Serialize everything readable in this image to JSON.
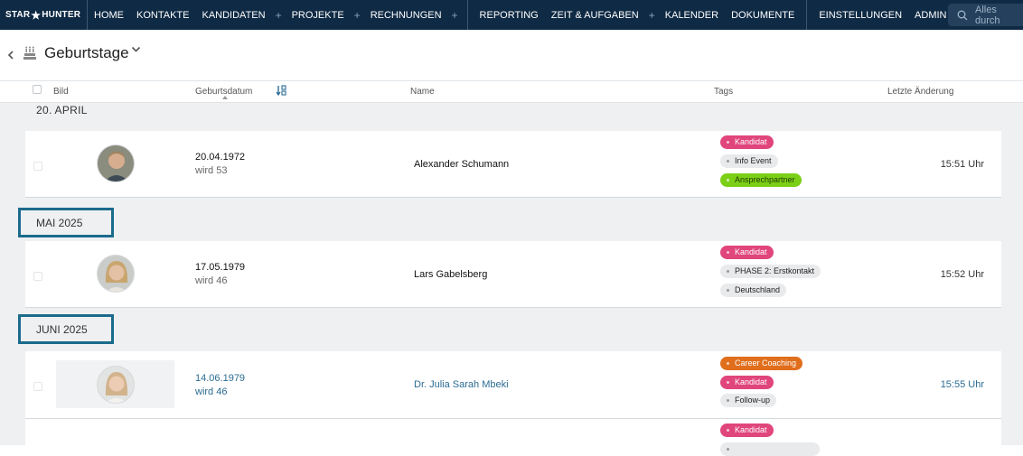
{
  "brand": {
    "logo_left": "STAR",
    "logo_right": "HUNTER"
  },
  "nav": {
    "items": [
      "HOME",
      "KONTAKTE",
      "KANDIDATEN",
      "PROJEKTE",
      "RECHNUNGEN",
      "REPORTING",
      "ZEIT & AUFGABEN",
      "KALENDER",
      "DOKUMENTE",
      "EINSTELLUNGEN",
      "ADMIN"
    ],
    "plus": "+",
    "search_placeholder": "Alles durch"
  },
  "page": {
    "title": "Geburtstage",
    "back_icon": "chevron-left-icon",
    "title_icon": "cake-icon"
  },
  "columns": {
    "bild": "Bild",
    "geburtsdatum": "Geburtsdatum",
    "name": "Name",
    "tags": "Tags",
    "letzte_aenderung": "Letzte Änderung"
  },
  "groups": {
    "april": "20. APRIL",
    "mai": "MAI 2025",
    "juni": "JUNI 2025"
  },
  "rows": [
    {
      "date": "20.04.1972",
      "age": "wird 53",
      "name": "Alexander Schumann",
      "time": "15:51 Uhr",
      "tags": [
        "Kandidat",
        "Info Event",
        "Ansprechpartner"
      ]
    },
    {
      "date": "17.05.1979",
      "age": "wird 46",
      "name": "Lars Gabelsberg",
      "time": "15:52 Uhr",
      "tags": [
        "Kandidat",
        "PHASE 2: Erstkontakt",
        "Deutschland"
      ]
    },
    {
      "date": "14.06.1979",
      "age": "wird 46",
      "name": "Dr. Julia Sarah Mbeki",
      "time": "15:55 Uhr",
      "tags": [
        "Career Coaching",
        "Kandidat",
        "Follow-up"
      ]
    },
    {
      "tags": [
        "Kandidat"
      ]
    }
  ],
  "colors": {
    "nav_bg": "#0f2a44",
    "accent": "#1b6b8c",
    "tag_pink": "#e0457c",
    "tag_green": "#7bcf16",
    "tag_orange": "#e06e1c",
    "link": "#2b6c93"
  }
}
